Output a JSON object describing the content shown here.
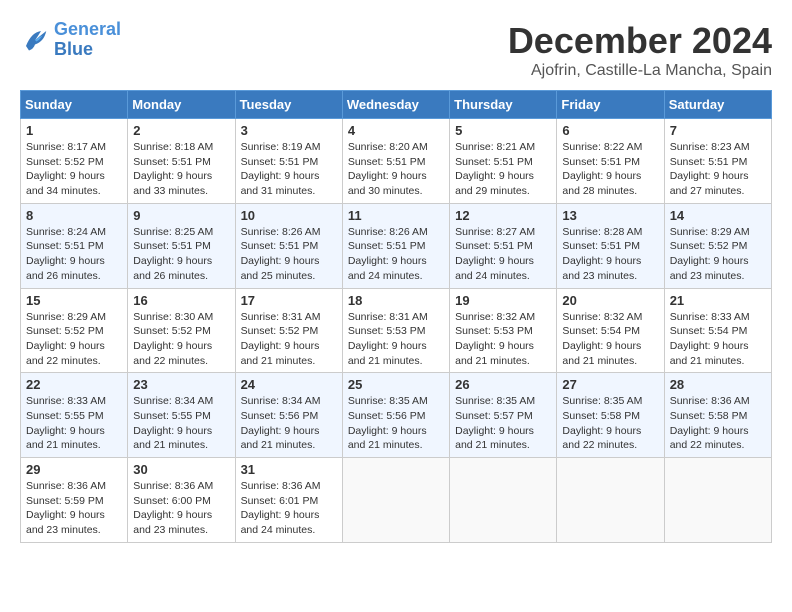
{
  "logo": {
    "line1": "General",
    "line2": "Blue"
  },
  "title": "December 2024",
  "location": "Ajofrin, Castille-La Mancha, Spain",
  "weekdays": [
    "Sunday",
    "Monday",
    "Tuesday",
    "Wednesday",
    "Thursday",
    "Friday",
    "Saturday"
  ],
  "weeks": [
    [
      {
        "day": "1",
        "sunrise": "8:17 AM",
        "sunset": "5:52 PM",
        "daylight": "9 hours and 34 minutes."
      },
      {
        "day": "2",
        "sunrise": "8:18 AM",
        "sunset": "5:51 PM",
        "daylight": "9 hours and 33 minutes."
      },
      {
        "day": "3",
        "sunrise": "8:19 AM",
        "sunset": "5:51 PM",
        "daylight": "9 hours and 31 minutes."
      },
      {
        "day": "4",
        "sunrise": "8:20 AM",
        "sunset": "5:51 PM",
        "daylight": "9 hours and 30 minutes."
      },
      {
        "day": "5",
        "sunrise": "8:21 AM",
        "sunset": "5:51 PM",
        "daylight": "9 hours and 29 minutes."
      },
      {
        "day": "6",
        "sunrise": "8:22 AM",
        "sunset": "5:51 PM",
        "daylight": "9 hours and 28 minutes."
      },
      {
        "day": "7",
        "sunrise": "8:23 AM",
        "sunset": "5:51 PM",
        "daylight": "9 hours and 27 minutes."
      }
    ],
    [
      {
        "day": "8",
        "sunrise": "8:24 AM",
        "sunset": "5:51 PM",
        "daylight": "9 hours and 26 minutes."
      },
      {
        "day": "9",
        "sunrise": "8:25 AM",
        "sunset": "5:51 PM",
        "daylight": "9 hours and 26 minutes."
      },
      {
        "day": "10",
        "sunrise": "8:26 AM",
        "sunset": "5:51 PM",
        "daylight": "9 hours and 25 minutes."
      },
      {
        "day": "11",
        "sunrise": "8:26 AM",
        "sunset": "5:51 PM",
        "daylight": "9 hours and 24 minutes."
      },
      {
        "day": "12",
        "sunrise": "8:27 AM",
        "sunset": "5:51 PM",
        "daylight": "9 hours and 24 minutes."
      },
      {
        "day": "13",
        "sunrise": "8:28 AM",
        "sunset": "5:51 PM",
        "daylight": "9 hours and 23 minutes."
      },
      {
        "day": "14",
        "sunrise": "8:29 AM",
        "sunset": "5:52 PM",
        "daylight": "9 hours and 23 minutes."
      }
    ],
    [
      {
        "day": "15",
        "sunrise": "8:29 AM",
        "sunset": "5:52 PM",
        "daylight": "9 hours and 22 minutes."
      },
      {
        "day": "16",
        "sunrise": "8:30 AM",
        "sunset": "5:52 PM",
        "daylight": "9 hours and 22 minutes."
      },
      {
        "day": "17",
        "sunrise": "8:31 AM",
        "sunset": "5:52 PM",
        "daylight": "9 hours and 21 minutes."
      },
      {
        "day": "18",
        "sunrise": "8:31 AM",
        "sunset": "5:53 PM",
        "daylight": "9 hours and 21 minutes."
      },
      {
        "day": "19",
        "sunrise": "8:32 AM",
        "sunset": "5:53 PM",
        "daylight": "9 hours and 21 minutes."
      },
      {
        "day": "20",
        "sunrise": "8:32 AM",
        "sunset": "5:54 PM",
        "daylight": "9 hours and 21 minutes."
      },
      {
        "day": "21",
        "sunrise": "8:33 AM",
        "sunset": "5:54 PM",
        "daylight": "9 hours and 21 minutes."
      }
    ],
    [
      {
        "day": "22",
        "sunrise": "8:33 AM",
        "sunset": "5:55 PM",
        "daylight": "9 hours and 21 minutes."
      },
      {
        "day": "23",
        "sunrise": "8:34 AM",
        "sunset": "5:55 PM",
        "daylight": "9 hours and 21 minutes."
      },
      {
        "day": "24",
        "sunrise": "8:34 AM",
        "sunset": "5:56 PM",
        "daylight": "9 hours and 21 minutes."
      },
      {
        "day": "25",
        "sunrise": "8:35 AM",
        "sunset": "5:56 PM",
        "daylight": "9 hours and 21 minutes."
      },
      {
        "day": "26",
        "sunrise": "8:35 AM",
        "sunset": "5:57 PM",
        "daylight": "9 hours and 21 minutes."
      },
      {
        "day": "27",
        "sunrise": "8:35 AM",
        "sunset": "5:58 PM",
        "daylight": "9 hours and 22 minutes."
      },
      {
        "day": "28",
        "sunrise": "8:36 AM",
        "sunset": "5:58 PM",
        "daylight": "9 hours and 22 minutes."
      }
    ],
    [
      {
        "day": "29",
        "sunrise": "8:36 AM",
        "sunset": "5:59 PM",
        "daylight": "9 hours and 23 minutes."
      },
      {
        "day": "30",
        "sunrise": "8:36 AM",
        "sunset": "6:00 PM",
        "daylight": "9 hours and 23 minutes."
      },
      {
        "day": "31",
        "sunrise": "8:36 AM",
        "sunset": "6:01 PM",
        "daylight": "9 hours and 24 minutes."
      },
      null,
      null,
      null,
      null
    ]
  ]
}
